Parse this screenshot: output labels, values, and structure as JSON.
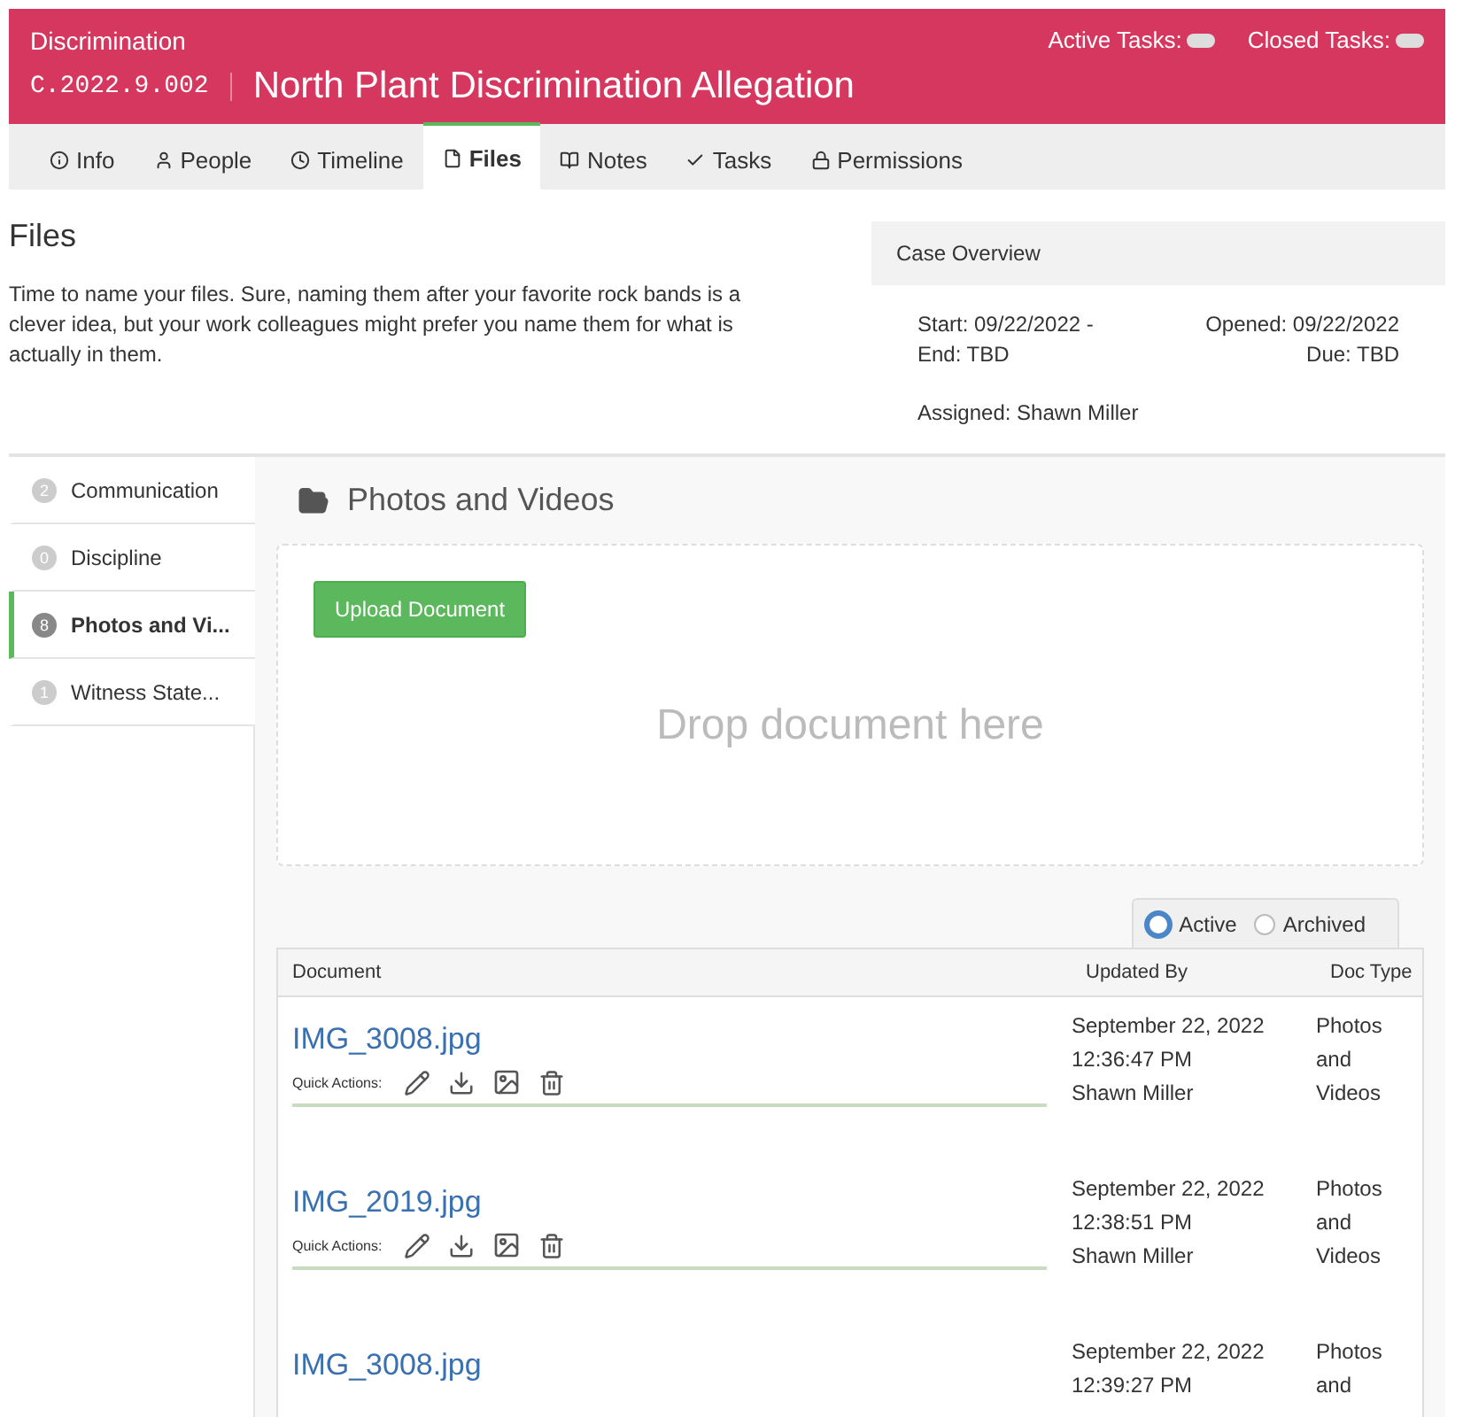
{
  "header": {
    "category": "Discrimination",
    "case_number": "C.2022.9.002",
    "title": "North Plant Discrimination Allegation",
    "task_indicators": [
      {
        "label": "Active Tasks:"
      },
      {
        "label": "Closed Tasks:"
      }
    ]
  },
  "tabs": [
    {
      "label": "Info",
      "selected": false
    },
    {
      "label": "People",
      "selected": false
    },
    {
      "label": "Timeline",
      "selected": false
    },
    {
      "label": "Files",
      "selected": true
    },
    {
      "label": "Notes",
      "selected": false
    },
    {
      "label": "Tasks",
      "selected": false
    },
    {
      "label": "Permissions",
      "selected": false
    }
  ],
  "intro": {
    "heading": "Files",
    "text": "Time to name your files. Sure, naming them after your favorite rock bands is a clever idea, but your work colleagues might prefer you name them for what is actually in them."
  },
  "case_overview": {
    "title": "Case Overview",
    "start": "Start: 09/22/2022 -",
    "end": "End: TBD",
    "opened": "Opened: 09/22/2022",
    "due": "Due: TBD",
    "assigned": "Assigned: Shawn Miller"
  },
  "categories": [
    {
      "count": "2",
      "label": "Communication",
      "selected": false
    },
    {
      "count": "0",
      "label": "Discipline",
      "selected": false
    },
    {
      "count": "8",
      "label": "Photos and Vi...",
      "selected": true
    },
    {
      "count": "1",
      "label": "Witness State...",
      "selected": false
    }
  ],
  "folder": {
    "title": "Photos and Videos",
    "upload_button": "Upload Document",
    "drop_hint": "Drop document here"
  },
  "filter": [
    {
      "label": "Active",
      "selected": true
    },
    {
      "label": "Archived",
      "selected": false
    }
  ],
  "table": {
    "columns": [
      "Document",
      "Updated By",
      "Doc Type"
    ],
    "rows": [
      {
        "document": "IMG_3008.jpg",
        "quick_actions_label": "Quick Actions:",
        "updated_date": "September 22, 2022",
        "updated_time": "12:36:47 PM",
        "updated_by": "Shawn Miller",
        "doc_type": "Photos and Videos"
      },
      {
        "document": "IMG_2019.jpg",
        "quick_actions_label": "Quick Actions:",
        "updated_date": "September 22, 2022",
        "updated_time": "12:38:51 PM",
        "updated_by": "Shawn Miller",
        "doc_type": "Photos and Videos"
      },
      {
        "document": "IMG_3008.jpg",
        "updated_date": "September 22, 2022",
        "updated_time": "12:39:27 PM",
        "doc_type": "Photos and"
      }
    ]
  }
}
